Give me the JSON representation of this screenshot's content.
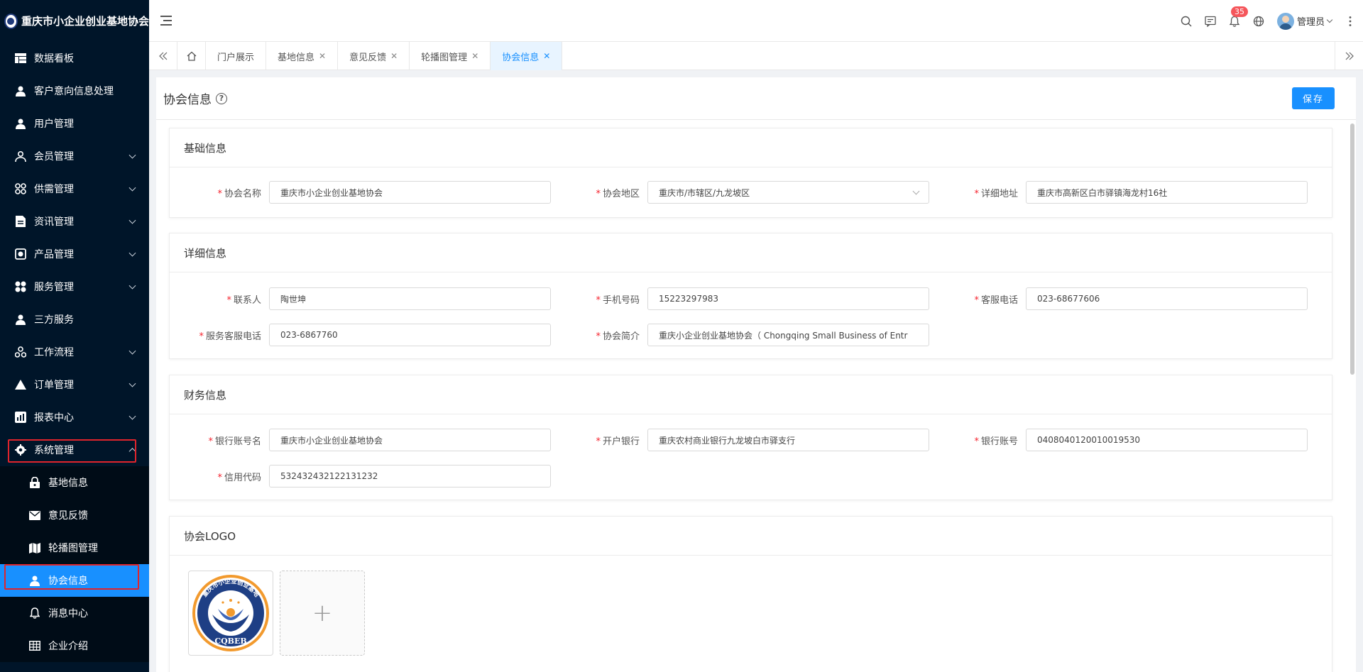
{
  "app": {
    "title": "重庆市小企业创业基地协会"
  },
  "sidebar": {
    "items": [
      {
        "label": "数据看板",
        "icon": "dashboard-icon",
        "has_arrow": false
      },
      {
        "label": "客户意向信息处理",
        "icon": "user-icon",
        "has_arrow": false
      },
      {
        "label": "用户管理",
        "icon": "user-icon",
        "has_arrow": false
      },
      {
        "label": "会员管理",
        "icon": "member-icon",
        "has_arrow": true
      },
      {
        "label": "供需管理",
        "icon": "apps-icon",
        "has_arrow": true
      },
      {
        "label": "资讯管理",
        "icon": "document-icon",
        "has_arrow": true
      },
      {
        "label": "产品管理",
        "icon": "product-icon",
        "has_arrow": true
      },
      {
        "label": "服务管理",
        "icon": "service-icon",
        "has_arrow": true
      },
      {
        "label": "三方服务",
        "icon": "user-icon",
        "has_arrow": false
      },
      {
        "label": "工作流程",
        "icon": "workflow-icon",
        "has_arrow": true
      },
      {
        "label": "订单管理",
        "icon": "triangle-icon",
        "has_arrow": true
      },
      {
        "label": "报表中心",
        "icon": "report-icon",
        "has_arrow": true
      },
      {
        "label": "系统管理",
        "icon": "gear-icon",
        "has_arrow": true,
        "expanded": true
      }
    ],
    "sub_items": [
      {
        "label": "基地信息",
        "icon": "lock-icon"
      },
      {
        "label": "意见反馈",
        "icon": "mail-icon"
      },
      {
        "label": "轮播图管理",
        "icon": "map-icon"
      },
      {
        "label": "协会信息",
        "icon": "user-icon",
        "active": true
      },
      {
        "label": "消息中心",
        "icon": "bell-icon"
      },
      {
        "label": "企业介绍",
        "icon": "table-icon"
      }
    ]
  },
  "header": {
    "notification_count": "35",
    "user_name": "管理员"
  },
  "tabs": [
    {
      "label": "门户展示",
      "closable": false
    },
    {
      "label": "基地信息",
      "closable": true
    },
    {
      "label": "意见反馈",
      "closable": true
    },
    {
      "label": "轮播图管理",
      "closable": true
    },
    {
      "label": "协会信息",
      "closable": true,
      "active": true
    }
  ],
  "page": {
    "title": "协会信息",
    "save_label": "保存"
  },
  "sections": {
    "basic": {
      "title": "基础信息",
      "name_label": "协会名称",
      "name_value": "重庆市小企业创业基地协会",
      "region_label": "协会地区",
      "region_value": "重庆市/市辖区/九龙坡区",
      "address_label": "详细地址",
      "address_value": "重庆市高新区白市驿镇海龙村16社"
    },
    "detail": {
      "title": "详细信息",
      "contact_label": "联系人",
      "contact_value": "陶世坤",
      "phone_label": "手机号码",
      "phone_value": "15223297983",
      "service_tel_label": "客服电话",
      "service_tel_value": "023-68677606",
      "service_hotline_label": "服务客服电话",
      "service_hotline_value": "023-6867760",
      "intro_label": "协会简介",
      "intro_value": "重庆小企业创业基地协会（ Chongqing Small Business of Entr"
    },
    "finance": {
      "title": "财务信息",
      "account_name_label": "银行账号名",
      "account_name_value": "重庆市小企业创业基地协会",
      "bank_label": "开户银行",
      "bank_value": "重庆农村商业银行九龙坡白市驿支行",
      "account_no_label": "银行账号",
      "account_no_value": "0408040120010019530",
      "credit_label": "信用代码",
      "credit_value": "532432432122131232"
    },
    "logo": {
      "title": "协会LOGO",
      "upload_symbol": "+",
      "logo_text": "CQBEB",
      "logo_ring_text": "重庆市小企业创业基地"
    }
  },
  "colors": {
    "sidebar_bg": "#001529",
    "primary": "#1890ff",
    "highlight_border": "#e0242c"
  }
}
